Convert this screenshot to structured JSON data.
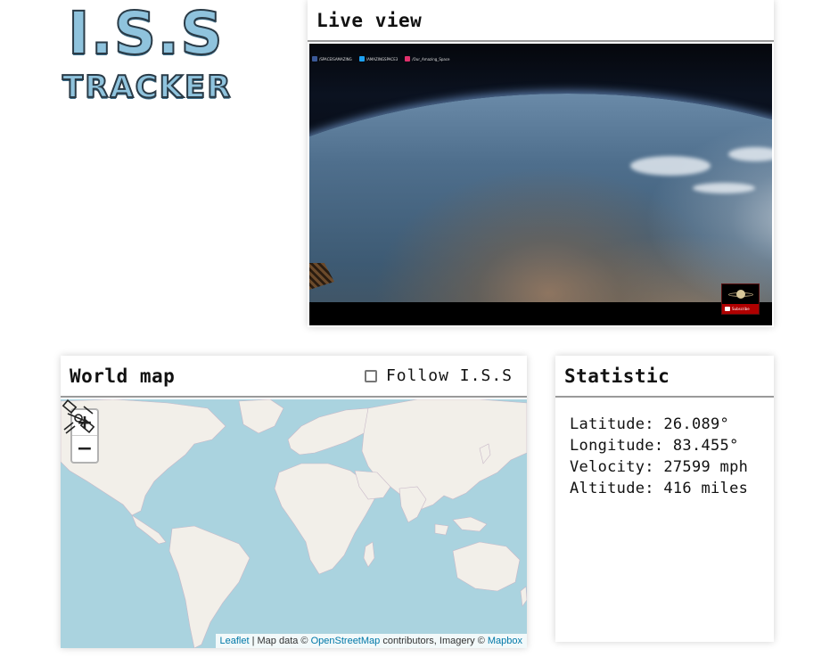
{
  "logo": {
    "line1": "I.S.S",
    "line2": "TRACKER",
    "colors": {
      "fill": "#8fc3dd",
      "outline": "#2a3b47"
    }
  },
  "live": {
    "title": "Live view",
    "video": {
      "social": [
        {
          "icon": "facebook-icon",
          "text": "/SPACEISAMAZING",
          "color": "#3b5998"
        },
        {
          "icon": "twitter-icon",
          "text": "/AMAZINGSPACE3",
          "color": "#1da1f2"
        },
        {
          "icon": "instagram-icon",
          "text": "/Our_Amazing_Space",
          "color": "#e1306c"
        }
      ],
      "channel_badge": "Subscribe"
    }
  },
  "worldmap": {
    "title": "World map",
    "follow_label": "Follow I.S.S",
    "follow_checked": false,
    "zoom_in": "+",
    "zoom_out": "−",
    "attribution": {
      "leaflet": "Leaflet",
      "sep": " | Map data © ",
      "osm": "OpenStreetMap",
      "mid": " contributors, Imagery © ",
      "mapbox": "Mapbox"
    },
    "colors": {
      "water": "#aad3df",
      "land": "#f2efe9",
      "link": "#0078a8"
    }
  },
  "stats": {
    "title": "Statistic",
    "latitude": "Latitude: 26.089°",
    "longitude": "Longitude: 83.455°",
    "velocity": "Velocity: 27599 mph",
    "altitude": "Altitude: 416 miles"
  }
}
